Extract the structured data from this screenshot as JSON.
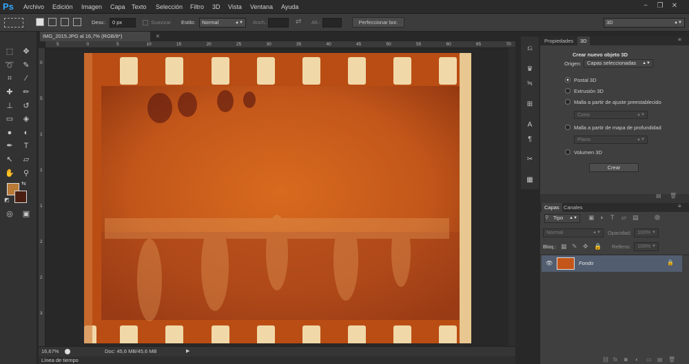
{
  "menubar": {
    "logo": "Ps",
    "items": [
      "Archivo",
      "Edición",
      "Imagen",
      "Capa",
      "Texto",
      "Selección",
      "Filtro",
      "3D",
      "Vista",
      "Ventana",
      "Ayuda"
    ],
    "window_controls": [
      "−",
      "❐",
      "✕"
    ]
  },
  "options": {
    "feather_label": "Desv.:",
    "feather_value": "0 px",
    "antialias_label": "Suavizar",
    "style_label": "Estilo:",
    "style_value": "Normal",
    "width_label": "Anch.:",
    "height_label": "Alt.:",
    "refine_btn": "Perfeccionar bor.",
    "workspace": "3D"
  },
  "document": {
    "tab_title": "IMG_2015.JPG al 16,7% (RGB/8*)",
    "zoom": "16,67%",
    "doc_info": "Doc: 45,6 MB/45,6 MB",
    "timeline": "Línea de tiempo"
  },
  "ruler": {
    "h": [
      "5",
      "0",
      "5",
      "10",
      "15",
      "20",
      "25",
      "30",
      "35",
      "40",
      "45",
      "50",
      "55",
      "60",
      "65",
      "70"
    ],
    "v": [
      "0",
      "5",
      "1",
      "1",
      "1",
      "2",
      "2",
      "3"
    ]
  },
  "panel3d": {
    "tabs": [
      "Propiedades",
      "3D"
    ],
    "title": "Crear nuevo objeto 3D",
    "source_label": "Origen:",
    "source_value": "Capas seleccionadas",
    "options": [
      {
        "label": "Postal 3D",
        "selected": true
      },
      {
        "label": "Extrusión 3D",
        "selected": false
      },
      {
        "label": "Malla a partir de ajuste preestablecido",
        "selected": false
      },
      {
        "label": "Malla a partir de mapa de profundidad",
        "selected": false
      },
      {
        "label": "Volumen 3D",
        "selected": false
      }
    ],
    "preset_value": "Cono",
    "depth_value": "Plano",
    "create_btn": "Crear"
  },
  "layers": {
    "tabs": [
      "Capas",
      "Canales"
    ],
    "filter": "Tipo",
    "blend": "Normal",
    "opacity_label": "Opacidad:",
    "opacity_value": "100%",
    "lock_label": "Bloq.:",
    "fill_label": "Relleno:",
    "fill_value": "100%",
    "layer_name": "Fondo"
  },
  "colors": {
    "foreground": "#b87a36",
    "background": "#4a1f12",
    "accent": "#31a8ff",
    "selected_layer": "#525d6f"
  }
}
